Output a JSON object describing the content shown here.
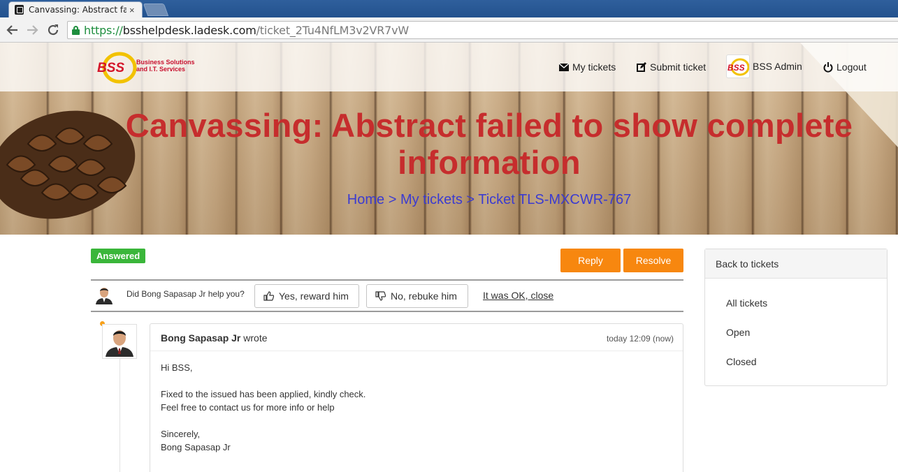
{
  "browser": {
    "tab_title": "Canvassing: Abstract failed to show complete information",
    "tab_close": "×",
    "url_scheme": "https://",
    "url_host": "bsshelpdesk.ladesk.com",
    "url_path": "/ticket_2Tu4NfLM3v2VR7vW"
  },
  "header": {
    "logo_text_line1": "Business Solutions",
    "logo_text_line2": "and I.T. Services",
    "logo_mark": "BSS",
    "nav": {
      "my_tickets": "My tickets",
      "submit_ticket": "Submit ticket",
      "user_name": "BSS Admin",
      "logout": "Logout"
    }
  },
  "hero": {
    "title": "Canvassing: Abstract failed to show complete information",
    "breadcrumb": "Home > My tickets > Ticket TLS-MXCWR-767"
  },
  "ticket": {
    "status": "Answered",
    "reply_label": "Reply",
    "resolve_label": "Resolve",
    "feedback_question": "Did Bong Sapasap Jr help you?",
    "reward_label": "Yes, reward him",
    "rebuke_label": "No, rebuke him",
    "ok_close_label": "It was OK, close"
  },
  "message": {
    "author": "Bong Sapasap Jr",
    "wrote": "wrote",
    "time": "today 12:09 (now)",
    "greeting": "Hi BSS,",
    "line1": "Fixed to the issued has been applied, kindly check.",
    "line2": "Feel free to contact us for more info or help",
    "closing": "Sincerely,",
    "signature": "Bong Sapasap Jr"
  },
  "side_panel": {
    "title": "Back to tickets",
    "items": [
      "All tickets",
      "Open",
      "Closed"
    ]
  },
  "colors": {
    "accent_orange": "#f7870f",
    "status_green": "#3ab63a",
    "title_red": "#c62d2d",
    "breadcrumb_blue": "#3b3bd0"
  }
}
